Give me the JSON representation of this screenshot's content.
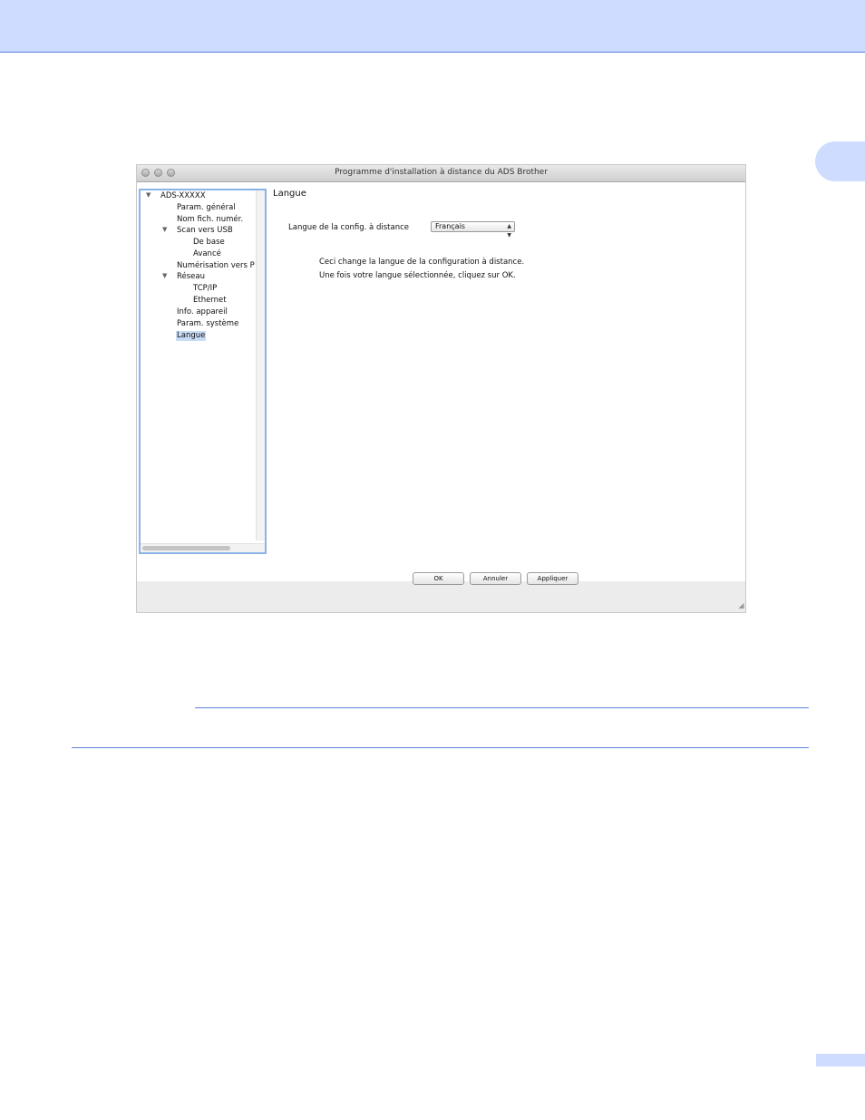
{
  "window": {
    "title": "Programme d'installation à distance du ADS Brother"
  },
  "sidebar": {
    "items": [
      {
        "label": "ADS-XXXXX"
      },
      {
        "label": "Param. général"
      },
      {
        "label": "Nom fich. numér."
      },
      {
        "label": "Scan vers USB"
      },
      {
        "label": "De base"
      },
      {
        "label": "Avancé"
      },
      {
        "label": "Numérisation vers P"
      },
      {
        "label": "Réseau"
      },
      {
        "label": "TCP/IP"
      },
      {
        "label": "Ethernet"
      },
      {
        "label": "Info. appareil"
      },
      {
        "label": "Param. système"
      },
      {
        "label": "Langue"
      }
    ],
    "selected": "Langue"
  },
  "panel": {
    "title": "Langue",
    "language_label": "Langue de la config. à distance",
    "language_value": "Français",
    "info_line_1": "Ceci change la langue de la configuration à distance.",
    "info_line_2": "Une fois votre langue sélectionnée, cliquez sur OK."
  },
  "buttons": {
    "ok": "OK",
    "cancel": "Annuler",
    "apply": "Appliquer"
  },
  "colors": {
    "header_band": "#cddcff",
    "accent_rule": "#5b7fe0",
    "selection": "#c8dcf6"
  }
}
